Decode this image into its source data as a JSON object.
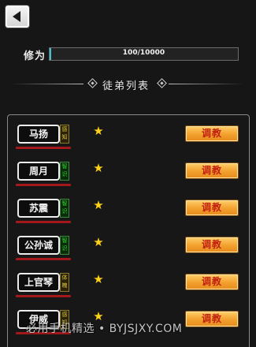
{
  "header": {
    "back_icon": "back-arrow-icon"
  },
  "cultivation": {
    "label": "修为",
    "progress_text": "100/10000",
    "progress_fraction": 0.01
  },
  "section": {
    "title": "徒弟列表"
  },
  "disciples": [
    {
      "name": "马扬",
      "aptitude": "感知",
      "aptitude_color": "gold",
      "stars": 1,
      "button": "调教"
    },
    {
      "name": "周月",
      "aptitude": "智识",
      "aptitude_color": "green",
      "stars": 1,
      "button": "调教"
    },
    {
      "name": "苏震",
      "aptitude": "智识",
      "aptitude_color": "green",
      "stars": 1,
      "button": "调教"
    },
    {
      "name": "公孙诚",
      "aptitude": "智识",
      "aptitude_color": "green",
      "stars": 1,
      "button": "调教"
    },
    {
      "name": "上官琴",
      "aptitude": "体魄",
      "aptitude_color": "gold",
      "stars": 1,
      "button": "调教"
    },
    {
      "name": "伊威",
      "aptitude": "感知",
      "aptitude_color": "gold",
      "stars": 1,
      "button": "调教"
    }
  ],
  "watermark": "必用手机精选 • BYJSJXY.COM",
  "colors": {
    "accent_cyan": "#3fc1d6",
    "button_orange": "#f2a02d",
    "button_text_red": "#c2200f",
    "star_yellow": "#ffd21a",
    "underline_red": "#a3191b"
  }
}
